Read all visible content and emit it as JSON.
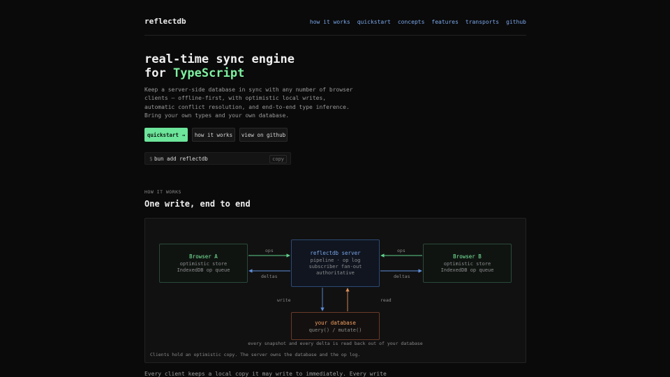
{
  "nav": {
    "brand": "reflectdb",
    "links": [
      "how it works",
      "quickstart",
      "concepts",
      "features",
      "transports",
      "github"
    ]
  },
  "hero": {
    "title_line1": "real-time sync engine",
    "title_prefix": "for ",
    "title_accent": "TypeScript",
    "description_lines": [
      "Keep a server-side database in sync with any number of browser",
      "clients — offline-first, with optimistic local writes,",
      "automatic conflict resolution, and end-to-end type inference.",
      "Bring your own types and your own database."
    ],
    "buttons": {
      "quickstart": "quickstart →",
      "how": "how it works",
      "github": "view on github"
    },
    "install": {
      "prompt": "$",
      "command": "bun add reflectdb",
      "copy": "copy"
    }
  },
  "section": {
    "eyebrow": "HOW IT WORKS",
    "title": "One write, end to end"
  },
  "diagram": {
    "browser_a": {
      "title": "Browser A",
      "lines": [
        "optimistic store",
        "IndexedDB op queue"
      ]
    },
    "browser_b": {
      "title": "Browser B",
      "lines": [
        "optimistic store",
        "IndexedDB op queue"
      ]
    },
    "server": {
      "title": "reflectdb server",
      "lines": [
        "pipeline · op log",
        "subscriber fan-out",
        "authoritative"
      ]
    },
    "database": {
      "title": "your database",
      "lines": [
        "query() / mutate()"
      ]
    },
    "edges": {
      "ops": "ops",
      "deltas": "deltas",
      "write": "write",
      "read": "read"
    },
    "caption_mid": "every snapshot and every delta is read back out of your database",
    "caption_bottom": "Clients hold an optimistic copy. The server owns the database and the op log.",
    "colors": {
      "green": "#5fd08a",
      "blue": "#5f8fd8",
      "orange": "#e0905a"
    }
  },
  "tail": "Every client keeps a local copy it may write to immediately. Every write"
}
